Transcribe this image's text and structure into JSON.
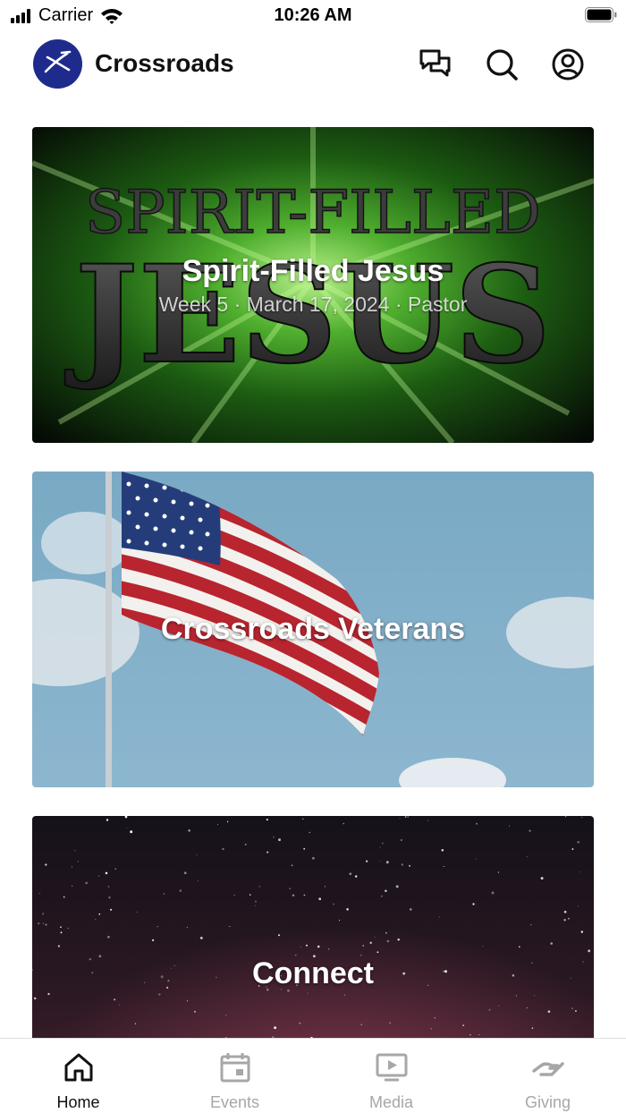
{
  "status_bar": {
    "carrier": "Carrier",
    "time": "10:26 AM"
  },
  "header": {
    "app_title": "Crossroads",
    "icons": [
      "chat-icon",
      "search-icon",
      "account-icon"
    ]
  },
  "cards": [
    {
      "title": "Spirit-Filled Jesus",
      "subtitle": "Week 5 · March 17, 2024 · Pastor",
      "image": "spirit-filled-jesus-artwork",
      "artwork_text": [
        "SPIRIT-FILLED",
        "JESUS"
      ]
    },
    {
      "title": "Crossroads Veterans",
      "image": "american-flag-photo"
    },
    {
      "title": "Connect",
      "image": "starry-night-photo"
    }
  ],
  "tabs": [
    {
      "label": "Home",
      "icon": "home-icon",
      "active": true
    },
    {
      "label": "Events",
      "icon": "calendar-icon",
      "active": false
    },
    {
      "label": "Media",
      "icon": "media-play-icon",
      "active": false
    },
    {
      "label": "Giving",
      "icon": "giving-hand-icon",
      "active": false
    }
  ],
  "colors": {
    "logo_background": "#1f2b8c",
    "active_tab": "#111111",
    "inactive_tab": "#a7a7a7"
  }
}
